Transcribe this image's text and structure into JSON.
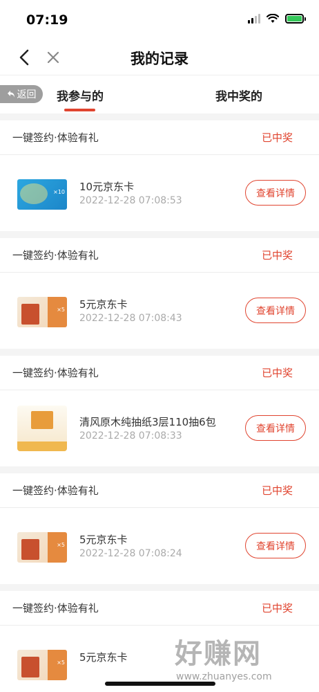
{
  "status_bar": {
    "time": "07:19"
  },
  "nav": {
    "title": "我的记录"
  },
  "tabs": {
    "back_label": "返回",
    "items": [
      {
        "label": "我参与的",
        "active": true
      },
      {
        "label": "我中奖的",
        "active": false
      }
    ]
  },
  "records": [
    {
      "name": "一键签约·体验有礼",
      "status": "已中奖",
      "prize": "10元京东卡",
      "time": "2022-12-28 07:08:53",
      "button": "查看详情",
      "image": "jd-card-10"
    },
    {
      "name": "一键签约·体验有礼",
      "status": "已中奖",
      "prize": "5元京东卡",
      "time": "2022-12-28 07:08:43",
      "button": "查看详情",
      "image": "jd-card-5"
    },
    {
      "name": "一键签约·体验有礼",
      "status": "已中奖",
      "prize": "清风原木纯抽纸3层110抽6包",
      "time": "2022-12-28 07:08:33",
      "button": "查看详情",
      "image": "tissue-pack"
    },
    {
      "name": "一键签约·体验有礼",
      "status": "已中奖",
      "prize": "5元京东卡",
      "time": "2022-12-28 07:08:24",
      "button": "查看详情",
      "image": "jd-card-5"
    },
    {
      "name": "一键签约·体验有礼",
      "status": "已中奖",
      "prize": "5元京东卡",
      "time": "",
      "button": "",
      "image": "jd-card-5"
    }
  ],
  "watermark": {
    "text": "好赚网",
    "url": "www.zhuanyes.com"
  },
  "colors": {
    "accent": "#e0442f",
    "background": "#f4f4f4"
  }
}
